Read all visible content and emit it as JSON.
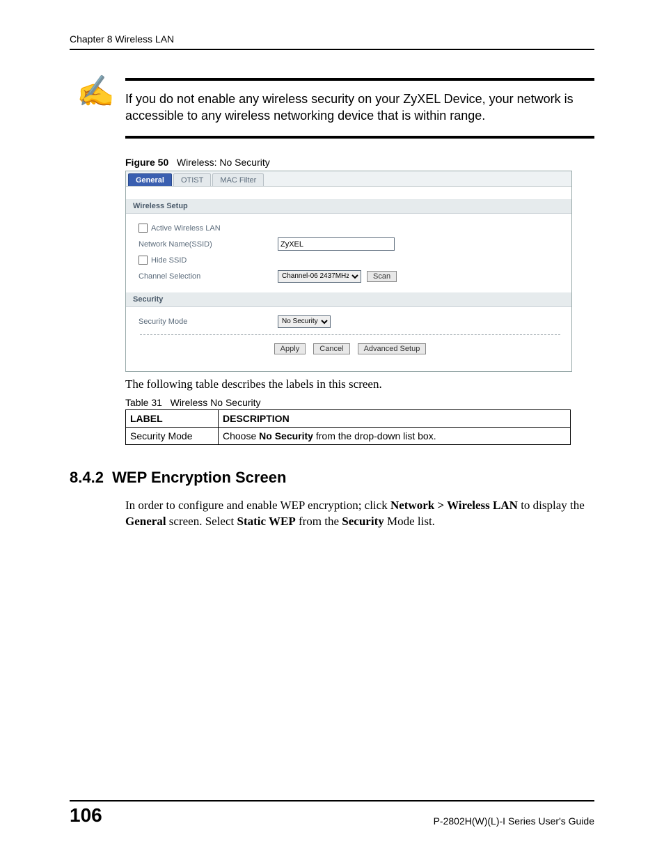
{
  "header": {
    "chapter_label": "Chapter 8 Wireless LAN"
  },
  "note": {
    "text": "If you do not enable any wireless security on your ZyXEL Device, your network is accessible to any wireless networking device that is within range."
  },
  "figure": {
    "label": "Figure 50",
    "title": "Wireless: No Security",
    "tabs": {
      "general": "General",
      "otist": "OTIST",
      "mac_filter": "MAC Filter"
    },
    "sections": {
      "wireless_setup": {
        "title": "Wireless Setup",
        "active_lan_label": "Active Wireless LAN",
        "ssid_label": "Network Name(SSID)",
        "ssid_value": "ZyXEL",
        "hide_ssid_label": "Hide SSID",
        "channel_label": "Channel Selection",
        "channel_value": "Channel-06 2437MHz",
        "scan_button": "Scan"
      },
      "security": {
        "title": "Security",
        "mode_label": "Security Mode",
        "mode_value": "No Security"
      }
    },
    "buttons": {
      "apply": "Apply",
      "cancel": "Cancel",
      "advanced": "Advanced Setup"
    }
  },
  "intro": "The following table describes the labels in this screen.",
  "table": {
    "label": "Table 31",
    "title": "Wireless No Security",
    "headers": {
      "label": "LABEL",
      "description": "DESCRIPTION"
    },
    "rows": [
      {
        "label": "Security Mode",
        "desc_pre": "Choose ",
        "desc_bold": "No Security",
        "desc_post": " from the drop-down list box."
      }
    ]
  },
  "section842": {
    "number": "8.4.2",
    "title": "WEP Encryption Screen",
    "para_parts": {
      "p1": "In order to configure and enable WEP encryption; click ",
      "b1": "Network > Wireless LAN",
      "p2": " to display the ",
      "b2": "General",
      "p3": " screen. Select ",
      "b3": "Static WEP",
      "p4": " from the ",
      "b4": "Security",
      "p5": " Mode list."
    }
  },
  "footer": {
    "page": "106",
    "guide": "P-2802H(W)(L)-I Series User's Guide"
  }
}
